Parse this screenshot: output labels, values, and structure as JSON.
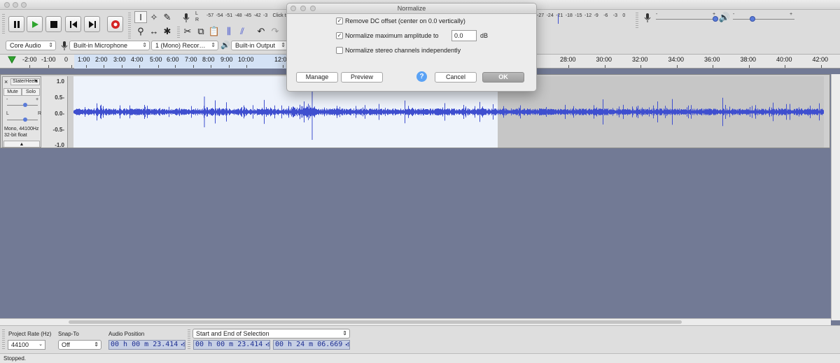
{
  "window": {
    "title": "Normalize"
  },
  "toolbar": {
    "icons": [
      "pause-icon",
      "play-icon",
      "stop-icon",
      "skip-start-icon",
      "skip-end-icon",
      "record-icon"
    ],
    "recording_meter_ticks": [
      "-57",
      "-54",
      "-51",
      "-48",
      "-45",
      "-42",
      "-3",
      "Click t"
    ],
    "playback_meter_ticks": [
      "-27",
      "-24",
      "-21",
      "-18",
      "-15",
      "-12",
      "-9",
      "-6",
      "-3",
      "0"
    ],
    "meter_l": "L",
    "meter_r": "R",
    "rec_slider_min": "-",
    "rec_slider_max": "+",
    "play_slider_min": "-",
    "play_slider_max": "+",
    "host": "Core Audio",
    "input_device": "Built-in Microphone",
    "channels": "1 (Mono) Recor…",
    "output_device": "Built-in Output"
  },
  "ruler": {
    "labels_left": [
      "-2:00",
      "-1:00",
      "0",
      "1:00",
      "2:00",
      "3:00",
      "4:00",
      "5:00",
      "6:00",
      "7:00",
      "8:00",
      "9:00",
      "10:00",
      "12:0"
    ],
    "labels_right": [
      "28:00",
      "30:00",
      "32:00",
      "34:00",
      "36:00",
      "38:00",
      "40:00",
      "42:00"
    ]
  },
  "track": {
    "name": "SlaterHeels",
    "mute": "Mute",
    "solo": "Solo",
    "gain_min": "-",
    "gain_max": "+",
    "pan_left": "L",
    "pan_right": "R",
    "format_line1": "Mono, 44100Hz",
    "format_line2": "32-bit float",
    "scale": [
      "1.0",
      "0.5-",
      "0.0-",
      "-0.5-",
      "-1.0"
    ],
    "waveform_color": "#3f4fcf",
    "selection_fraction": 0.565
  },
  "dialog": {
    "title": "Normalize",
    "dc_offset_label": "Remove DC offset (center on 0.0 vertically)",
    "dc_offset_checked": true,
    "normalize_label": "Normalize maximum amplitude to",
    "normalize_checked": true,
    "amplitude_value": "0.0",
    "amplitude_unit": "dB",
    "stereo_label": "Normalize stereo channels independently",
    "stereo_checked": false,
    "manage": "Manage",
    "preview": "Preview",
    "help": "?",
    "cancel": "Cancel",
    "ok": "OK"
  },
  "selection_toolbar": {
    "project_rate_label": "Project Rate (Hz)",
    "project_rate": "44100",
    "snap_label": "Snap-To",
    "snap_value": "Off",
    "audio_position_label": "Audio Position",
    "audio_position": "00 h 00 m 23.414 s",
    "selection_mode": "Start and End of Selection",
    "selection_start": "00 h 00 m 23.414 s",
    "selection_end": "00 h 24 m 06.669 s"
  },
  "status": "Stopped."
}
